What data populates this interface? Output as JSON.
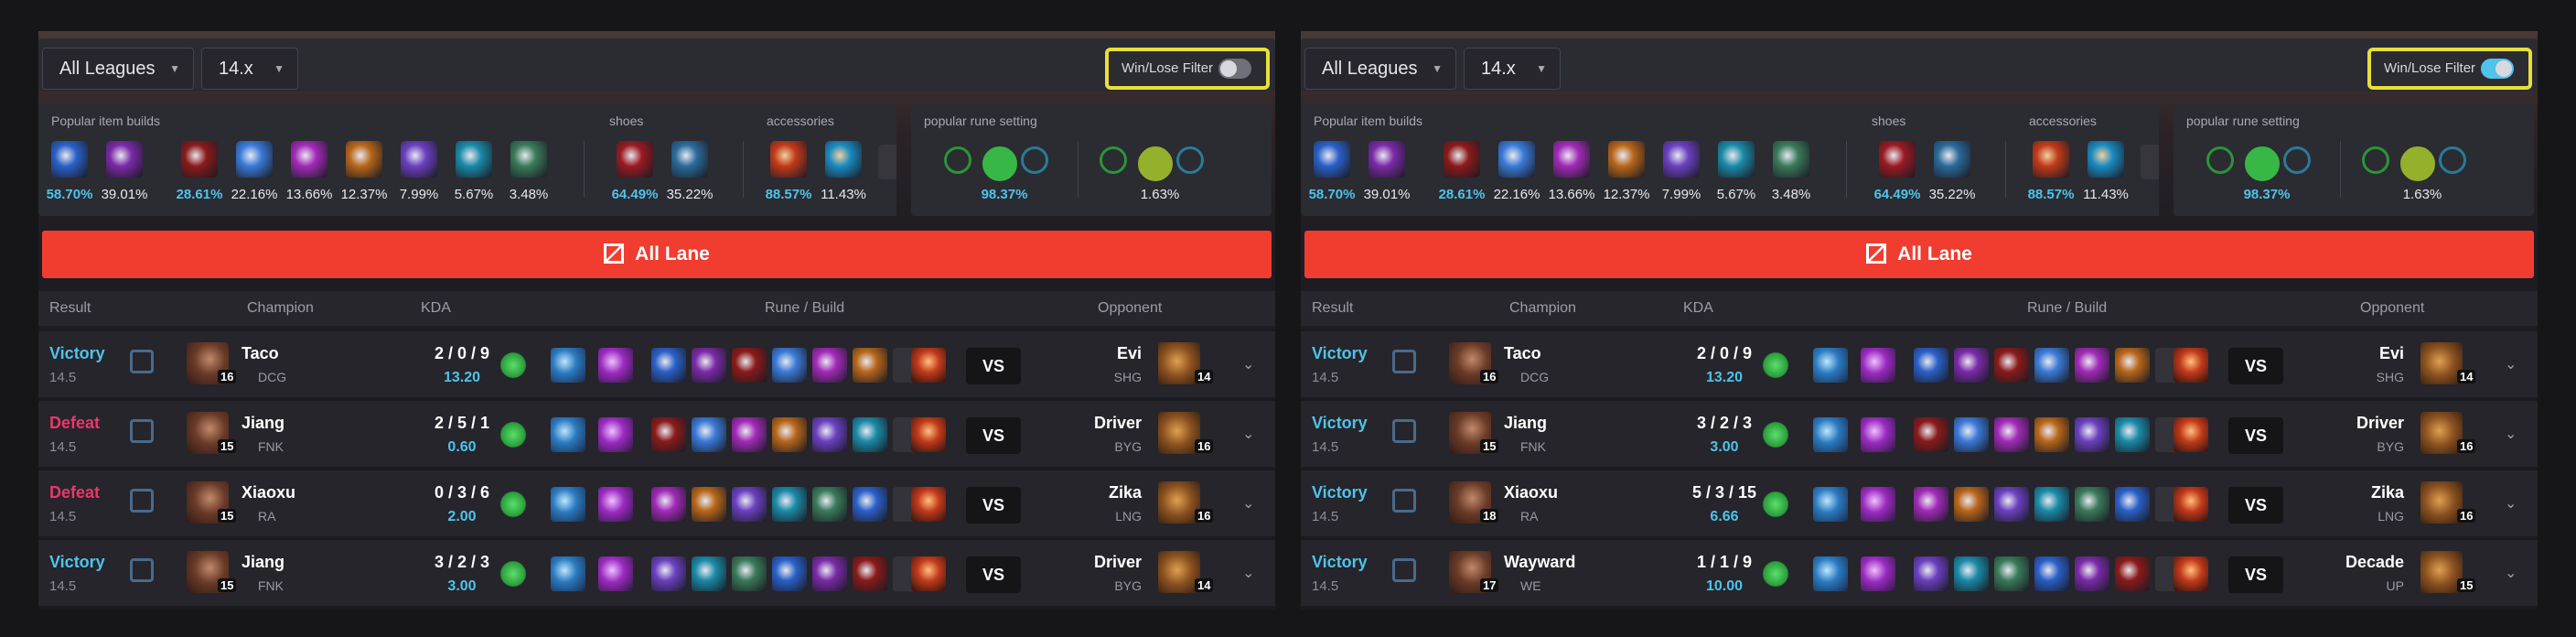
{
  "colors": {
    "victory": "#4fc3ea",
    "defeat": "#f0356a",
    "lane": "#f03d30",
    "highlight": "#e8e03a",
    "toggle_off": "#70707a",
    "toggle_on": "#4fc3ea"
  },
  "labels": {
    "section_items": "Popular item builds",
    "section_shoes": "shoes",
    "section_accessories": "accessories",
    "section_runes": "popular rune setting",
    "lane": "All Lane",
    "lane_icon": "lane-all-icon",
    "head_result": "Result",
    "head_champion": "Champion",
    "head_kda": "KDA",
    "head_rune": "Rune / Build",
    "head_opponent": "Opponent",
    "vs": "VS",
    "win_lose": "Win/Lose Filter"
  },
  "panels": [
    {
      "league": "All Leagues",
      "patch": "14.x",
      "win_lose_on": false,
      "item_pcts": [
        "58.70%",
        "39.01%",
        "28.61%",
        "22.16%",
        "13.66%",
        "12.37%",
        "7.99%",
        "5.67%",
        "3.48%"
      ],
      "shoe_pcts": [
        "64.49%",
        "35.22%"
      ],
      "acc_pcts": [
        "88.57%",
        "11.43%"
      ],
      "rune_pcts": [
        "98.37%",
        "1.63%"
      ],
      "rows": [
        {
          "result": "Victory",
          "win": true,
          "version": "14.5",
          "level": "16",
          "player": "Taco",
          "team": "DCG",
          "kda": "2 / 0 / 9",
          "ratio": "13.20",
          "opponent": "Evi",
          "opp_team": "SHG",
          "opp_level": "14"
        },
        {
          "result": "Defeat",
          "win": false,
          "version": "14.5",
          "level": "15",
          "player": "Jiang",
          "team": "FNK",
          "kda": "2 / 5 / 1",
          "ratio": "0.60",
          "opponent": "Driver",
          "opp_team": "BYG",
          "opp_level": "16"
        },
        {
          "result": "Defeat",
          "win": false,
          "version": "14.5",
          "level": "15",
          "player": "Xiaoxu",
          "team": "RA",
          "kda": "0 / 3 / 6",
          "ratio": "2.00",
          "opponent": "Zika",
          "opp_team": "LNG",
          "opp_level": "16"
        },
        {
          "result": "Victory",
          "win": true,
          "version": "14.5",
          "level": "15",
          "player": "Jiang",
          "team": "FNK",
          "kda": "3 / 2 / 3",
          "ratio": "3.00",
          "opponent": "Driver",
          "opp_team": "BYG",
          "opp_level": "14"
        }
      ]
    },
    {
      "league": "All Leagues",
      "patch": "14.x",
      "win_lose_on": true,
      "item_pcts": [
        "58.70%",
        "39.01%",
        "28.61%",
        "22.16%",
        "13.66%",
        "12.37%",
        "7.99%",
        "5.67%",
        "3.48%"
      ],
      "shoe_pcts": [
        "64.49%",
        "35.22%"
      ],
      "acc_pcts": [
        "88.57%",
        "11.43%"
      ],
      "rune_pcts": [
        "98.37%",
        "1.63%"
      ],
      "rows": [
        {
          "result": "Victory",
          "win": true,
          "version": "14.5",
          "level": "16",
          "player": "Taco",
          "team": "DCG",
          "kda": "2 / 0 / 9",
          "ratio": "13.20",
          "opponent": "Evi",
          "opp_team": "SHG",
          "opp_level": "14"
        },
        {
          "result": "Victory",
          "win": true,
          "version": "14.5",
          "level": "15",
          "player": "Jiang",
          "team": "FNK",
          "kda": "3 / 2 / 3",
          "ratio": "3.00",
          "opponent": "Driver",
          "opp_team": "BYG",
          "opp_level": "16"
        },
        {
          "result": "Victory",
          "win": true,
          "version": "14.5",
          "level": "18",
          "player": "Xiaoxu",
          "team": "RA",
          "kda": "5 / 3 / 15",
          "ratio": "6.66",
          "opponent": "Zika",
          "opp_team": "LNG",
          "opp_level": "16"
        },
        {
          "result": "Victory",
          "win": true,
          "version": "14.5",
          "level": "17",
          "player": "Wayward",
          "team": "WE",
          "kda": "1 / 1 / 9",
          "ratio": "10.00",
          "opponent": "Decade",
          "opp_team": "UP",
          "opp_level": "15"
        }
      ]
    }
  ]
}
